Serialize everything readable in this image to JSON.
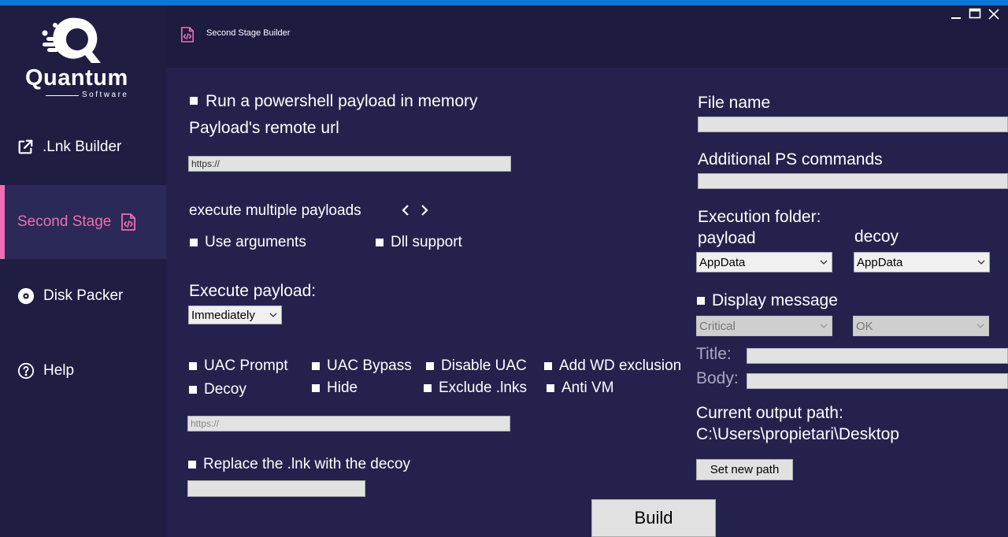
{
  "app": {
    "logo_word": "Quantum",
    "logo_sub": "Software",
    "header_title": "Second Stage Builder"
  },
  "sidebar": {
    "items": [
      {
        "label": ".Lnk Builder",
        "icon": "external-link-icon"
      },
      {
        "label": "Second Stage",
        "icon": "code-file-icon"
      },
      {
        "label": "Disk Packer",
        "icon": "disc-icon"
      },
      {
        "label": "Help",
        "icon": "help-icon"
      }
    ]
  },
  "main": {
    "run_ps_label": "Run a powershell payload in memory",
    "remote_url_label": "Payload's remote url",
    "remote_url_value": "https://",
    "multi_label": "execute multiple payloads",
    "use_args_label": "Use arguments",
    "dll_label": "Dll support",
    "exec_payload_label": "Execute payload:",
    "exec_payload_value": "Immediately",
    "opts": {
      "uac_prompt": "UAC Prompt",
      "uac_bypass": "UAC Bypass",
      "disable_uac": "Disable UAC",
      "add_wd": "Add WD exclusion",
      "decoy": "Decoy",
      "hide": "Hide",
      "exclude_lnks": "Exclude .lnks",
      "anti_vm": "Anti VM"
    },
    "decoy_url_value": "https://",
    "replace_label": "Replace the .lnk with the decoy",
    "replace_value": ""
  },
  "right": {
    "file_name_label": "File name",
    "file_name_value": "",
    "add_ps_label": "Additional PS commands",
    "add_ps_value": "",
    "exec_folder_label": "Execution folder:",
    "payload_label": "payload",
    "decoy_label": "decoy",
    "payload_folder": "AppData",
    "decoy_folder": "AppData",
    "display_msg_label": "Display message",
    "msg_type": "Critical",
    "msg_button": "OK",
    "title_label": "Title:",
    "title_value": "",
    "body_label": "Body:",
    "body_value": "",
    "output_label": "Current output path:",
    "output_path": "C:\\Users\\propietari\\Desktop",
    "set_path_label": "Set new path"
  },
  "build_label": "Build",
  "colors": {
    "accent_pink": "#ee6eb3",
    "bg_main": "#24224d",
    "bg_sidebar": "#1f1d42",
    "top_accent": "#0a78d7"
  }
}
